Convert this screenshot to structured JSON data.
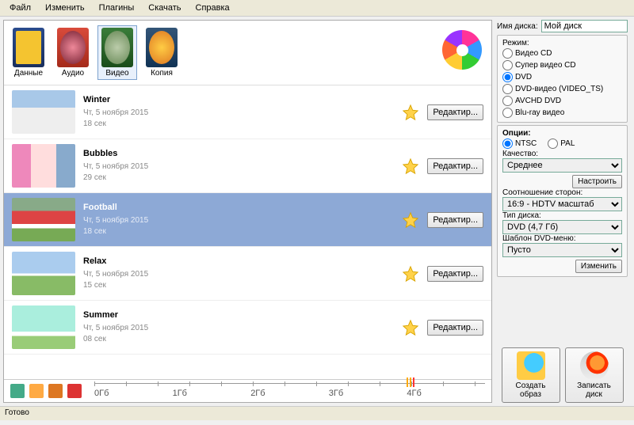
{
  "menu": [
    "Файл",
    "Изменить",
    "Плагины",
    "Скачать",
    "Справка"
  ],
  "tools": [
    {
      "label": "Данные",
      "icon": "ti-data"
    },
    {
      "label": "Аудио",
      "icon": "ti-audio"
    },
    {
      "label": "Видео",
      "icon": "ti-video",
      "active": true
    },
    {
      "label": "Копия",
      "icon": "ti-copy"
    }
  ],
  "items": [
    {
      "title": "Winter",
      "date": "Чт, 5 ноября 2015",
      "dur": "18 сек",
      "thumb": "th0"
    },
    {
      "title": "Bubbles",
      "date": "Чт, 5 ноября 2015",
      "dur": "29 сек",
      "thumb": "th1"
    },
    {
      "title": "Football",
      "date": "Чт, 5 ноября 2015",
      "dur": "18 сек",
      "thumb": "th2",
      "selected": true
    },
    {
      "title": "Relax",
      "date": "Чт, 5 ноября 2015",
      "dur": "15 сек",
      "thumb": "th3"
    },
    {
      "title": "Summer",
      "date": "Чт, 5 ноября 2015",
      "dur": "08 сек",
      "thumb": "th4"
    }
  ],
  "edit_label": "Редактир...",
  "scale": [
    "0Гб",
    "1Гб",
    "2Гб",
    "3Гб",
    "4Гб",
    ""
  ],
  "disc_name_label": "Имя диска:",
  "disc_name_value": "Мой диск",
  "mode_label": "Режим:",
  "modes": [
    "Видео CD",
    "Супер видео CD",
    "DVD",
    "DVD-видео (VIDEO_TS)",
    "AVCHD DVD",
    "Blu-ray видео"
  ],
  "mode_selected": "DVD",
  "options_label": "Опции:",
  "opt_ntsc": "NTSC",
  "opt_pal": "PAL",
  "opt_selected": "NTSC",
  "quality_label": "Качество:",
  "quality_value": "Среднее",
  "configure_btn": "Настроить",
  "aspect_label": "Соотношение сторон:",
  "aspect_value": "16:9 - HDTV масштаб",
  "disc_type_label": "Тип диска:",
  "disc_type_value": "DVD (4,7 Гб)",
  "menu_tpl_label": "Шаблон DVD-меню:",
  "menu_tpl_value": "Пусто",
  "change_btn": "Изменить",
  "create_image_btn": "Создать образ",
  "burn_disc_btn": "Записать диск",
  "status": "Готово"
}
